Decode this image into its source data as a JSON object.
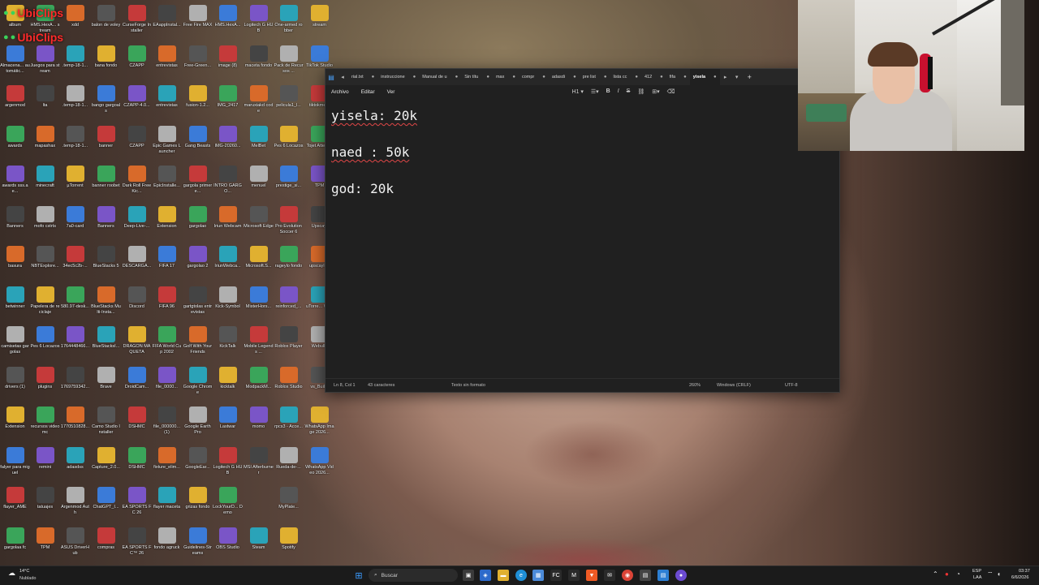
{
  "desktop": {
    "columns": [
      [
        "album",
        "Almacena... automátic...",
        "argenmod",
        "awards",
        "awards sss.ae...",
        "Banners",
        "basura",
        "betwinner",
        "camisetas gargolas",
        "drivers (1)",
        "Extension",
        "falyer para miguel",
        "flayer_AME",
        "gargolaa fc"
      ],
      [
        "HMS.HexA... stream",
        "Juegos para stream",
        "lta",
        "mapashax",
        "minecraft",
        "mofo cstrts",
        "NBTExplore...",
        "Papelera de reciclaje",
        "Pes 6 Locazos",
        "plugins",
        "recursos video mc",
        "remini",
        "tatuajes",
        "TPM"
      ],
      [
        "xdd",
        ".temp-18-1...",
        ".temp-18-1...",
        ".temp-18-1...",
        "µTorrent",
        "7a0-card",
        "34ec5c2b-...",
        "580.97-desk...",
        "1764448466...",
        "1769759342...",
        "1770510828...",
        "adasdss",
        "Argenmod Auth",
        "ASUS DriverHub"
      ],
      [
        "balon de voley",
        "bana fondo",
        "bango gargoals",
        "banner",
        "banner roobet",
        "Banners",
        "BlueStacks 5",
        "BlueStacks Multi-Insta...",
        "BlueStacksI...",
        "Brave",
        "Camo Studio Installer",
        "Capture_2.0...",
        "ChatGPT_I...",
        "compras"
      ],
      [
        "CurseForge Installer",
        "CZAPP",
        "CZAPP-4.0...",
        "CZAPP",
        "Dark Roll Free Kic...",
        "Deep-Live-...",
        "DESCARGA...",
        "Discord",
        "DRAGON MAQUETA",
        "DroidCam...",
        "DSHMC",
        "DSHMC",
        "EA SPORTS FC 26",
        "EA SPORTS FC™ 26"
      ],
      [
        "EAappInstal...",
        "entrevistas",
        "entrevistas",
        "Epic Games Launcher",
        "EpicInstalle...",
        "Extension",
        "FIFA 17",
        "FIFA 96",
        "FIFA World Cup 2002",
        "file_0000...",
        "file_000000... (1)",
        "fixture_elim...",
        "flayer maceta",
        "fondo agruck"
      ],
      [
        "Free Fire MAX",
        "Free-Green...",
        "fusion-1.2...",
        "Gang Beasts",
        "gargola primer e...",
        "gargolao",
        "gargolao 2",
        "gartgtolas entrevistas",
        "Golf With Your Friends",
        "Google Chrome",
        "Google Earth Pro",
        "GoogleEar...",
        "grizas fondo",
        "Guidelines-Streams"
      ],
      [
        "HMS.HexA...",
        "image (8)",
        "IMG_2417",
        "IMG-20260...",
        "INTRO GARGO...",
        "Iriun Webcam",
        "IriunWebca...",
        "Kick-Symbol",
        "KickTalk",
        "kicktalk",
        "Lastwar",
        "Logitech G HUB",
        "LockYourD... Demo",
        "OBS Studio"
      ],
      [
        "Logitech G HUB",
        "maceta fondo",
        "maruxiakd code",
        "MelBet",
        "menuel",
        "Microsoft Edge",
        "Microsoft.S...",
        "MisterHors...",
        "Mobile Legends ...",
        "ModpackM...",
        "momo",
        "MSI Afterburner",
        "",
        "Steam"
      ],
      [
        "One-armed robber",
        "Pack de Recursos ...",
        "pelicula1_l...",
        "Pes 6 Locazos",
        "prestige_si...",
        "Pro Evolution Soccer 6",
        "rageylo fondo",
        "reinforced_...",
        "Roblox Player",
        "Roblox Studio",
        "rpcs3 - Acce...",
        "Rueda-de-...",
        "MyPlate...",
        "Spotify"
      ],
      [
        "stream",
        "TikTok Studio",
        "tiktokme...",
        "Tojet Attent...",
        "TPM",
        "Upscayl",
        "upscayl-...",
        "uTorre... Web",
        "Webull..",
        "vs_Buil...",
        "WhatsApp Image 2026...",
        "WhatsApp Video 2026...",
        "",
        ""
      ]
    ],
    "overlay_text": [
      "UbiClips",
      "UbiClips"
    ]
  },
  "notepad": {
    "tabs": [
      "rial.txt",
      "instruccione",
      "Manual de u",
      "Sin títu",
      "max",
      "compr",
      "adasdi",
      "pre list",
      "lista cc",
      "412",
      "fifa",
      "yisela"
    ],
    "active_tab": "yisela",
    "menu": [
      "Archivo",
      "Editar",
      "Ver"
    ],
    "heading_select": "H1",
    "lines": [
      "yisela: 20k",
      "",
      "naed : 50k",
      "",
      "god: 20k"
    ],
    "status": {
      "position": "Ln 8, Col 1",
      "chars": "43 caracteres",
      "format": "Texto sin formato",
      "zoom": "260%",
      "line_ending": "Windows (CRLF)",
      "encoding": "UTF-8"
    }
  },
  "taskbar": {
    "weather_temp": "14°C",
    "weather_desc": "Nublado",
    "search_placeholder": "Buscar",
    "lang": "ESP",
    "lang_sub": "LAA",
    "time": "03:37",
    "date": "6/6/2026"
  }
}
